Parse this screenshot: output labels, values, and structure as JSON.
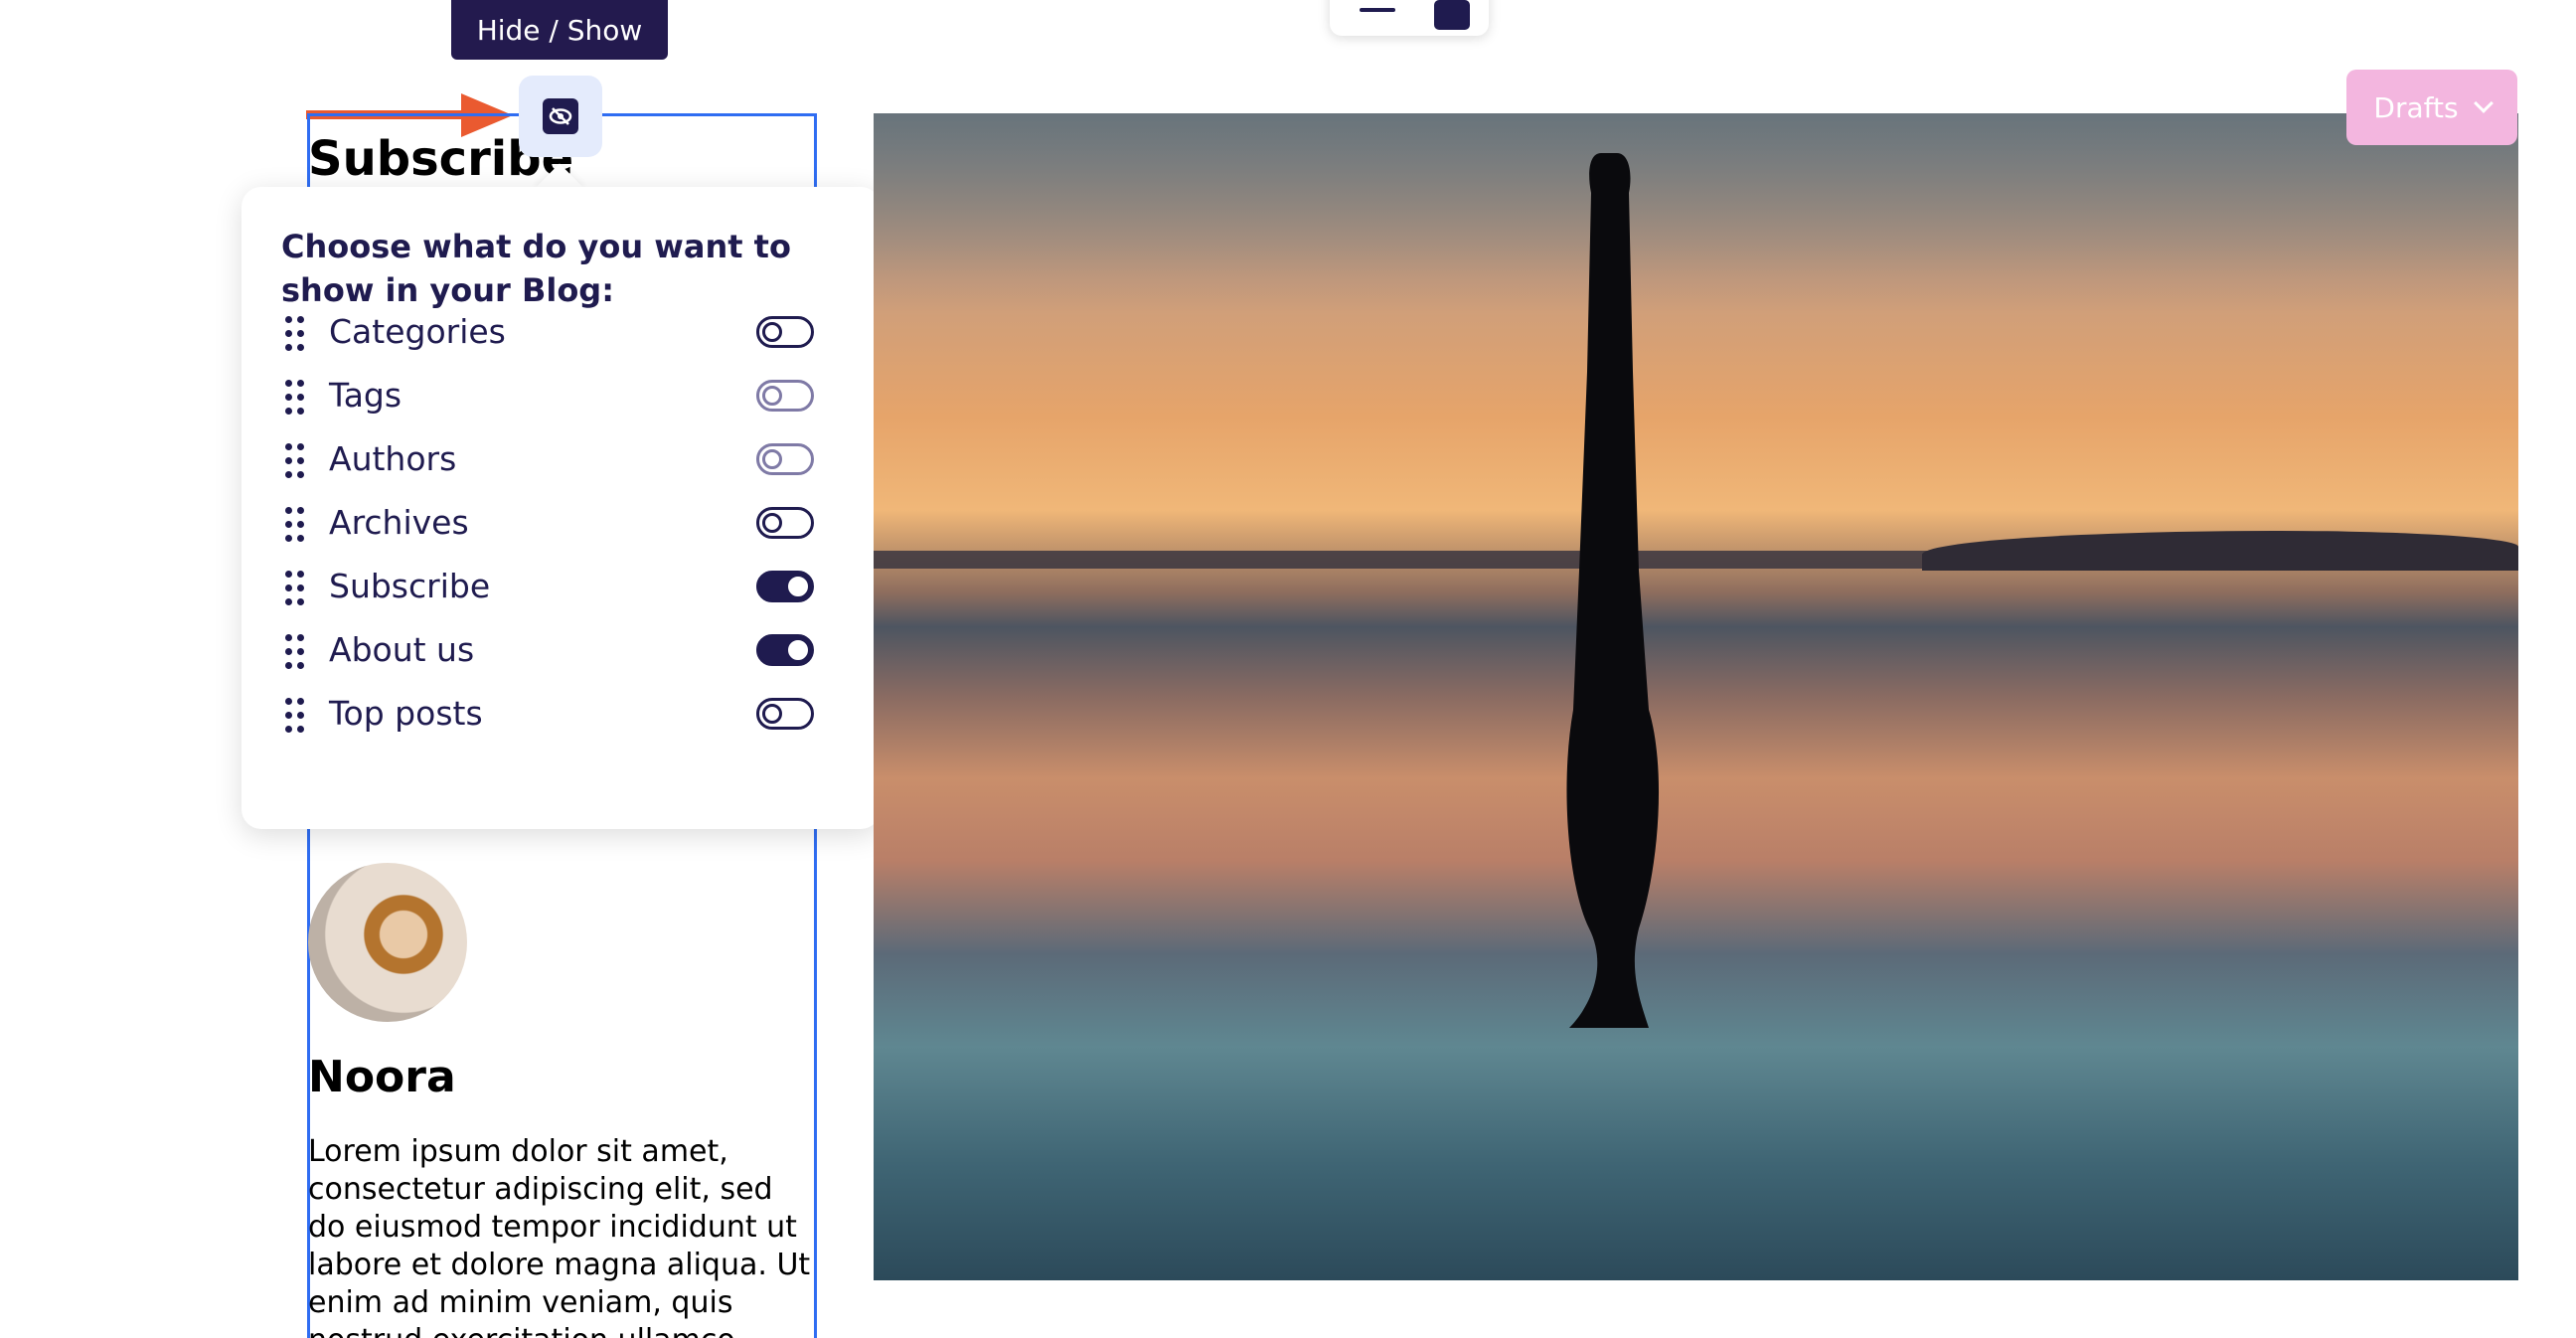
{
  "tooltip": {
    "label": "Hide / Show"
  },
  "sidebar": {
    "subscribe_heading": "Subscribe",
    "author_name": "Noora",
    "author_bio": "Lorem ipsum dolor sit amet, consectetur adipiscing elit, sed do eiusmod tempor incididunt ut labore et dolore magna aliqua. Ut enim ad minim veniam, quis nostrud exercitation ullamco"
  },
  "panel": {
    "title": "Choose what do you want to show in your Blog:",
    "options": [
      {
        "label": "Categories",
        "enabled": false
      },
      {
        "label": "Tags",
        "enabled": false
      },
      {
        "label": "Authors",
        "enabled": false
      },
      {
        "label": "Archives",
        "enabled": false
      },
      {
        "label": "Subscribe",
        "enabled": true
      },
      {
        "label": "About us",
        "enabled": true
      },
      {
        "label": "Top posts",
        "enabled": false
      }
    ]
  },
  "drafts": {
    "label": "Drafts"
  },
  "colors": {
    "accent_dark": "#1f1b4f",
    "selection_outline": "#2f6df2",
    "arrow": "#ea5a30",
    "drafts_bg": "#f3b6df"
  },
  "icons": {
    "hide_show": "eye-slash-icon",
    "drag": "drag-handle-icon",
    "drafts": "chevron-down-icon"
  }
}
